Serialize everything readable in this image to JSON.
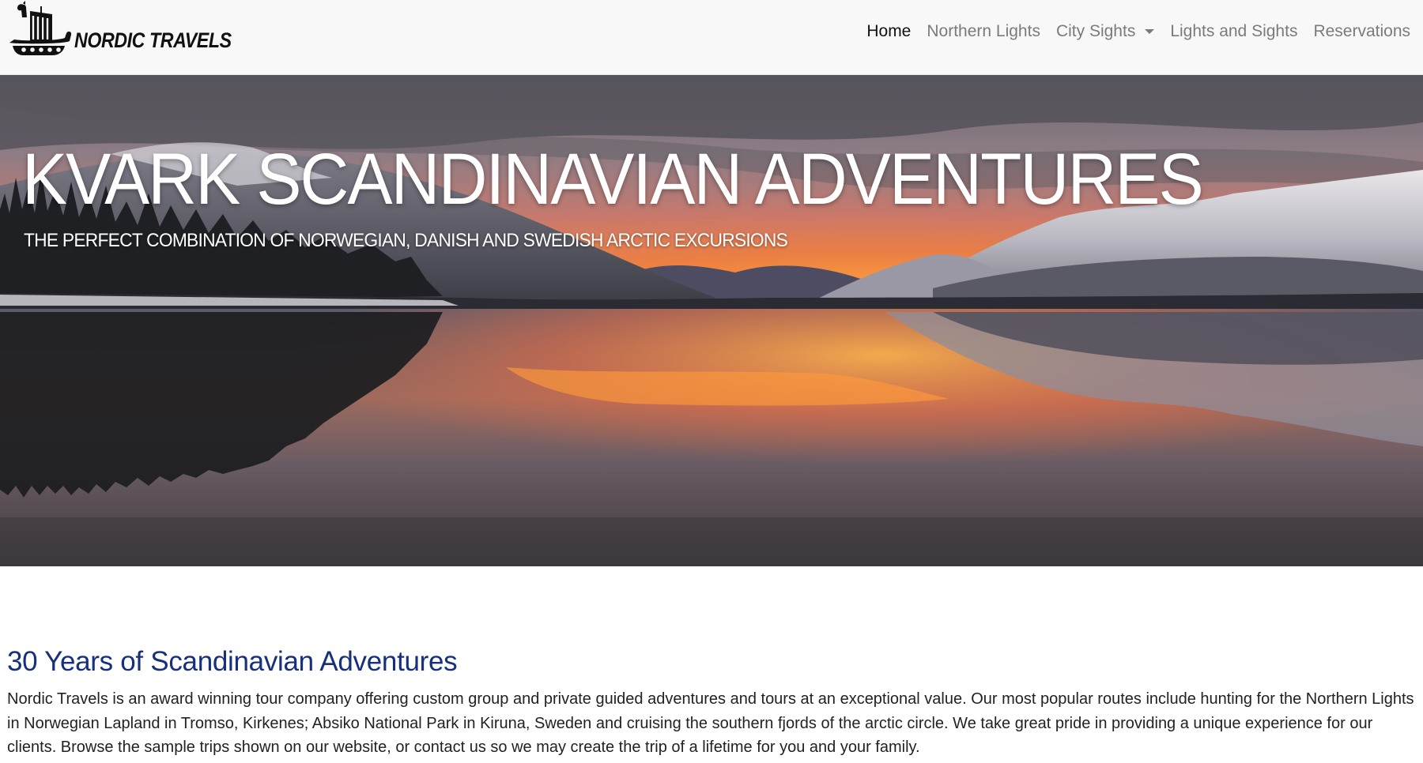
{
  "brand": {
    "name": "NORDIC TRAVELS"
  },
  "nav": {
    "items": [
      {
        "label": "Home",
        "active": true
      },
      {
        "label": "Northern Lights",
        "active": false
      },
      {
        "label": "City Sights",
        "active": false,
        "dropdown": true
      },
      {
        "label": "Lights and Sights",
        "active": false
      },
      {
        "label": "Reservations",
        "active": false
      }
    ]
  },
  "hero": {
    "title": "KVARK SCANDINAVIAN ADVENTURES",
    "subtitle": "THE PERFECT COMBINATION OF NORWEGIAN, DANISH AND SWEDISH ARCTIC EXCURSIONS"
  },
  "intro": {
    "heading": "30 Years of Scandinavian Adventures",
    "body": "Nordic Travels is an award winning tour company offering custom group and private guided adventures and tours at an exceptional value. Our most popular routes include hunting for the Northern Lights in Norwegian Lapland in Tromso, Kirkenes; Absiko National Park in Kiruna, Sweden and cruising the southern fjords of the arctic circle. We take great pride in providing a unique experience for our clients. Browse the sample trips shown on our website, or contact us so we may create the trip of a lifetime for you and your family."
  },
  "colors": {
    "navbar_bg": "#f8f8f8",
    "nav_link": "#7b7b7b",
    "nav_link_active": "#111111",
    "heading": "#16307c"
  },
  "icons": {
    "logo": "viking-ship-icon",
    "dropdown": "caret-down-icon"
  }
}
